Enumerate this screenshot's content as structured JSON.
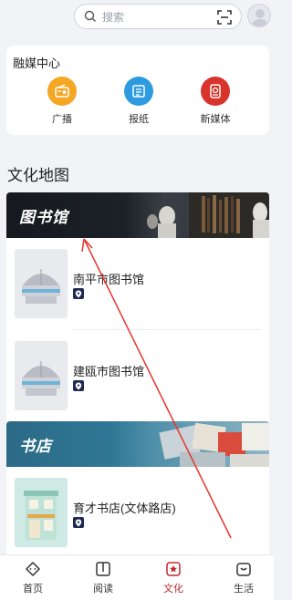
{
  "search": {
    "placeholder": "搜索"
  },
  "media_center": {
    "title": "融媒中心",
    "items": [
      {
        "label": "广播",
        "icon": "radio-icon",
        "color": "#f5a623"
      },
      {
        "label": "报纸",
        "icon": "newspaper-icon",
        "color": "#2e9be0"
      },
      {
        "label": "新媒体",
        "icon": "new-media-icon",
        "color": "#d8342b"
      }
    ]
  },
  "culture_map": {
    "title": "文化地图",
    "library_banner": "图书馆",
    "libraries": [
      {
        "name": "南平市图书馆"
      },
      {
        "name": "建瓯市图书馆"
      }
    ],
    "bookstore_banner": "书店",
    "bookstores": [
      {
        "name": "育才书店(文体路店)"
      }
    ]
  },
  "tabs": [
    {
      "label": "首页",
      "icon": "home-icon",
      "active": false
    },
    {
      "label": "阅读",
      "icon": "book-icon",
      "active": false
    },
    {
      "label": "文化",
      "icon": "culture-icon",
      "active": true
    },
    {
      "label": "生活",
      "icon": "life-bag-icon",
      "active": false
    }
  ],
  "colors": {
    "accent": "#c0282d",
    "pin": "#1f2a55",
    "annotation_arrow": "#e8342c"
  }
}
